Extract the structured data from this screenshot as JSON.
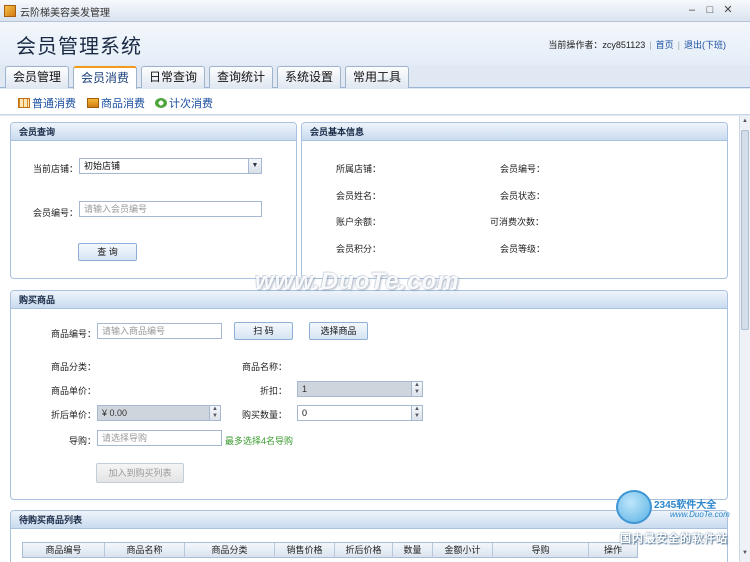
{
  "window": {
    "title": "云阶梯美容美发管理"
  },
  "header": {
    "system_title": "会员管理系统",
    "operator_label": "当前操作者：",
    "operator_name": "zcy851123",
    "home_link": "首页",
    "logout_link": "退出(下班)"
  },
  "tabs": [
    {
      "label": "会员管理"
    },
    {
      "label": "会员消费",
      "active": true
    },
    {
      "label": "日常查询"
    },
    {
      "label": "查询统计"
    },
    {
      "label": "系统设置"
    },
    {
      "label": "常用工具"
    }
  ],
  "subnav": [
    {
      "label": "普通消费",
      "icon": "table-icon"
    },
    {
      "label": "商品消费",
      "icon": "gift-icon"
    },
    {
      "label": "计次消费",
      "icon": "refresh-icon"
    }
  ],
  "member_query": {
    "title": "会员查询",
    "store_label": "当前店铺：",
    "store_value": "初始店铺",
    "member_no_label": "会员编号：",
    "member_no_placeholder": "请输入会员编号",
    "query_button": "查 询"
  },
  "member_info": {
    "title": "会员基本信息",
    "fields": {
      "store": "所属店铺：",
      "member_no": "会员编号：",
      "name": "会员姓名：",
      "status": "会员状态：",
      "balance": "账户余额：",
      "remaining_times": "可消费次数：",
      "points": "会员积分：",
      "level": "会员等级："
    }
  },
  "purchase": {
    "title": "购买商品",
    "product_no_label": "商品编号：",
    "product_no_placeholder": "请输入商品编号",
    "scan_button": "扫 码",
    "select_button": "选择商品",
    "category_label": "商品分类：",
    "name_label": "商品名称：",
    "unit_price_label": "商品单价：",
    "discount_label": "折扣：",
    "discount_value": "1",
    "discounted_price_label": "折后单价：",
    "discounted_price_value": "¥ 0.00",
    "quantity_label": "购买数量：",
    "quantity_value": "0",
    "guide_label": "导购：",
    "guide_placeholder": "请选择导购",
    "guide_hint": "最多选择4名导购",
    "add_button": "加入到购买列表"
  },
  "pending_list": {
    "title": "待购买商品列表",
    "columns": [
      "商品编号",
      "商品名称",
      "商品分类",
      "销售价格",
      "折后价格",
      "数量",
      "金额小计",
      "导购",
      "操作"
    ]
  },
  "watermark": "www.DuoTe.com",
  "badge": {
    "brand": "2345软件大全",
    "url": "www.DuoTe.com",
    "slogan": "国内最安全的软件站"
  }
}
